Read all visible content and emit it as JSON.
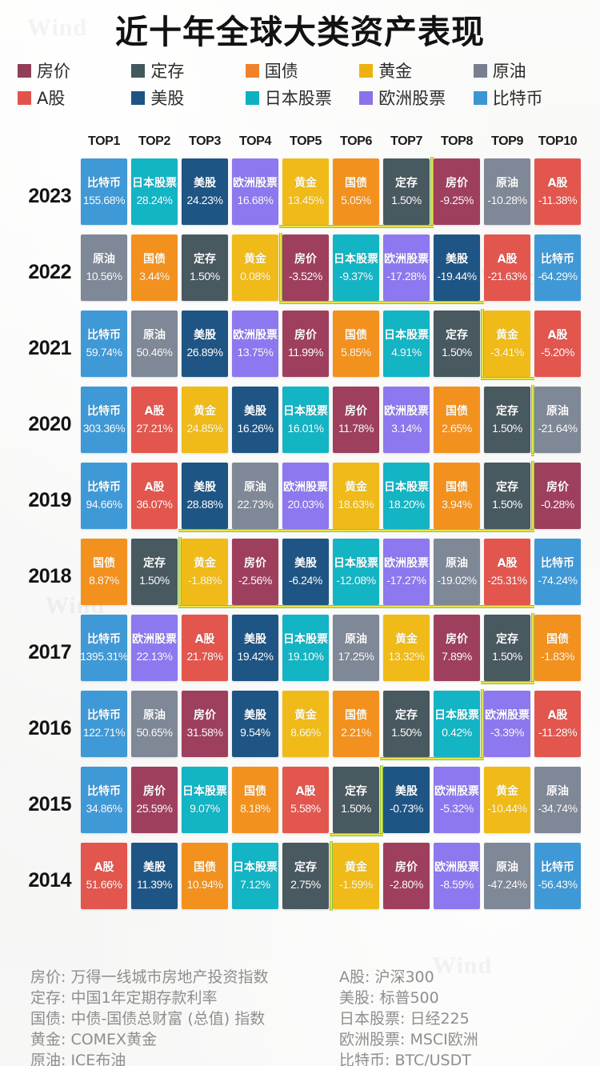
{
  "title": "近十年全球大类资产表现",
  "legend": [
    {
      "label": "房价",
      "color": "#8f3f56"
    },
    {
      "label": "定存",
      "color": "#41585c"
    },
    {
      "label": "国债",
      "color": "#f08129"
    },
    {
      "label": "黄金",
      "color": "#edb211"
    },
    {
      "label": "原油",
      "color": "#78808f"
    },
    {
      "label": "A股",
      "color": "#e0544c"
    },
    {
      "label": "美股",
      "color": "#1d5483"
    },
    {
      "label": "日本股票",
      "color": "#0eb0c0"
    },
    {
      "label": "欧洲股票",
      "color": "#8b72e8"
    },
    {
      "label": "比特币",
      "color": "#3b96d2"
    }
  ],
  "asset_colors": {
    "房价": "#9e3f5e",
    "定存": "#48595f",
    "国债": "#f3911f",
    "黄金": "#f0bb18",
    "原油": "#7f8897",
    "A股": "#e2564e",
    "美股": "#1e5585",
    "日本股票": "#13b4c4",
    "欧洲股票": "#8d78ef",
    "比特币": "#3f99d6"
  },
  "columns": [
    "TOP1",
    "TOP2",
    "TOP3",
    "TOP4",
    "TOP5",
    "TOP6",
    "TOP7",
    "TOP8",
    "TOP9",
    "TOP10"
  ],
  "chart_data": {
    "type": "table",
    "title": "近十年全球大类资产表现",
    "xlabel": "",
    "ylabel": "",
    "columns": [
      "TOP1",
      "TOP2",
      "TOP3",
      "TOP4",
      "TOP5",
      "TOP6",
      "TOP7",
      "TOP8",
      "TOP9",
      "TOP10"
    ],
    "rows": [
      {
        "year": "2023",
        "cells": [
          {
            "asset": "比特币",
            "value": "155.68%"
          },
          {
            "asset": "日本股票",
            "value": "28.24%"
          },
          {
            "asset": "美股",
            "value": "24.23%"
          },
          {
            "asset": "欧洲股票",
            "value": "16.68%"
          },
          {
            "asset": "黄金",
            "value": "13.45%"
          },
          {
            "asset": "国债",
            "value": "5.05%"
          },
          {
            "asset": "定存",
            "value": "1.50%"
          },
          {
            "asset": "房价",
            "value": "-9.25%"
          },
          {
            "asset": "原油",
            "value": "-10.28%"
          },
          {
            "asset": "A股",
            "value": "-11.38%"
          }
        ]
      },
      {
        "year": "2022",
        "cells": [
          {
            "asset": "原油",
            "value": "10.56%"
          },
          {
            "asset": "国债",
            "value": "3.44%"
          },
          {
            "asset": "定存",
            "value": "1.50%"
          },
          {
            "asset": "黄金",
            "value": "0.08%"
          },
          {
            "asset": "房价",
            "value": "-3.52%"
          },
          {
            "asset": "日本股票",
            "value": "-9.37%"
          },
          {
            "asset": "欧洲股票",
            "value": "-17.28%"
          },
          {
            "asset": "美股",
            "value": "-19.44%"
          },
          {
            "asset": "A股",
            "value": "-21.63%"
          },
          {
            "asset": "比特币",
            "value": "-64.29%"
          }
        ]
      },
      {
        "year": "2021",
        "cells": [
          {
            "asset": "比特币",
            "value": "59.74%"
          },
          {
            "asset": "原油",
            "value": "50.46%"
          },
          {
            "asset": "美股",
            "value": "26.89%"
          },
          {
            "asset": "欧洲股票",
            "value": "13.75%"
          },
          {
            "asset": "房价",
            "value": "11.99%"
          },
          {
            "asset": "国债",
            "value": "5.85%"
          },
          {
            "asset": "日本股票",
            "value": "4.91%"
          },
          {
            "asset": "定存",
            "value": "1.50%"
          },
          {
            "asset": "黄金",
            "value": "-3.41%"
          },
          {
            "asset": "A股",
            "value": "-5.20%"
          }
        ]
      },
      {
        "year": "2020",
        "cells": [
          {
            "asset": "比特币",
            "value": "303.36%"
          },
          {
            "asset": "A股",
            "value": "27.21%"
          },
          {
            "asset": "黄金",
            "value": "24.85%"
          },
          {
            "asset": "美股",
            "value": "16.26%"
          },
          {
            "asset": "日本股票",
            "value": "16.01%"
          },
          {
            "asset": "房价",
            "value": "11.78%"
          },
          {
            "asset": "欧洲股票",
            "value": "3.14%"
          },
          {
            "asset": "国债",
            "value": "2.65%"
          },
          {
            "asset": "定存",
            "value": "1.50%"
          },
          {
            "asset": "原油",
            "value": "-21.64%"
          }
        ]
      },
      {
        "year": "2019",
        "cells": [
          {
            "asset": "比特币",
            "value": "94.66%"
          },
          {
            "asset": "A股",
            "value": "36.07%"
          },
          {
            "asset": "美股",
            "value": "28.88%"
          },
          {
            "asset": "原油",
            "value": "22.73%"
          },
          {
            "asset": "欧洲股票",
            "value": "20.03%"
          },
          {
            "asset": "黄金",
            "value": "18.63%"
          },
          {
            "asset": "日本股票",
            "value": "18.20%"
          },
          {
            "asset": "国债",
            "value": "3.94%"
          },
          {
            "asset": "定存",
            "value": "1.50%"
          },
          {
            "asset": "房价",
            "value": "-0.28%"
          }
        ]
      },
      {
        "year": "2018",
        "cells": [
          {
            "asset": "国债",
            "value": "8.87%"
          },
          {
            "asset": "定存",
            "value": "1.50%"
          },
          {
            "asset": "黄金",
            "value": "-1.88%"
          },
          {
            "asset": "房价",
            "value": "-2.56%"
          },
          {
            "asset": "美股",
            "value": "-6.24%"
          },
          {
            "asset": "日本股票",
            "value": "-12.08%"
          },
          {
            "asset": "欧洲股票",
            "value": "-17.27%"
          },
          {
            "asset": "原油",
            "value": "-19.02%"
          },
          {
            "asset": "A股",
            "value": "-25.31%"
          },
          {
            "asset": "比特币",
            "value": "-74.24%"
          }
        ]
      },
      {
        "year": "2017",
        "cells": [
          {
            "asset": "比特币",
            "value": "1395.31%"
          },
          {
            "asset": "欧洲股票",
            "value": "22.13%"
          },
          {
            "asset": "A股",
            "value": "21.78%"
          },
          {
            "asset": "美股",
            "value": "19.42%"
          },
          {
            "asset": "日本股票",
            "value": "19.10%"
          },
          {
            "asset": "原油",
            "value": "17.25%"
          },
          {
            "asset": "黄金",
            "value": "13.32%"
          },
          {
            "asset": "房价",
            "value": "7.89%"
          },
          {
            "asset": "定存",
            "value": "1.50%"
          },
          {
            "asset": "国债",
            "value": "-1.83%"
          }
        ]
      },
      {
        "year": "2016",
        "cells": [
          {
            "asset": "比特币",
            "value": "122.71%"
          },
          {
            "asset": "原油",
            "value": "50.65%"
          },
          {
            "asset": "房价",
            "value": "31.58%"
          },
          {
            "asset": "美股",
            "value": "9.54%"
          },
          {
            "asset": "黄金",
            "value": "8.66%"
          },
          {
            "asset": "国债",
            "value": "2.21%"
          },
          {
            "asset": "定存",
            "value": "1.50%"
          },
          {
            "asset": "日本股票",
            "value": "0.42%"
          },
          {
            "asset": "欧洲股票",
            "value": "-3.39%"
          },
          {
            "asset": "A股",
            "value": "-11.28%"
          }
        ]
      },
      {
        "year": "2015",
        "cells": [
          {
            "asset": "比特币",
            "value": "34.86%"
          },
          {
            "asset": "房价",
            "value": "25.59%"
          },
          {
            "asset": "日本股票",
            "value": "9.07%"
          },
          {
            "asset": "国债",
            "value": "8.18%"
          },
          {
            "asset": "A股",
            "value": "5.58%"
          },
          {
            "asset": "定存",
            "value": "1.50%"
          },
          {
            "asset": "美股",
            "value": "-0.73%"
          },
          {
            "asset": "欧洲股票",
            "value": "-5.32%"
          },
          {
            "asset": "黄金",
            "value": "-10.44%"
          },
          {
            "asset": "原油",
            "value": "-34.74%"
          }
        ]
      },
      {
        "year": "2014",
        "cells": [
          {
            "asset": "A股",
            "value": "51.66%"
          },
          {
            "asset": "美股",
            "value": "11.39%"
          },
          {
            "asset": "国债",
            "value": "10.94%"
          },
          {
            "asset": "日本股票",
            "value": "7.12%"
          },
          {
            "asset": "定存",
            "value": "2.75%"
          },
          {
            "asset": "黄金",
            "value": "-1.59%"
          },
          {
            "asset": "房价",
            "value": "-2.80%"
          },
          {
            "asset": "欧洲股票",
            "value": "-8.59%"
          },
          {
            "asset": "原油",
            "value": "-47.24%"
          },
          {
            "asset": "比特币",
            "value": "-56.43%"
          }
        ]
      }
    ],
    "annotation": "黄绿色阶梯线标示各年度正负收益分界",
    "positive_counts": [
      7,
      4,
      8,
      9,
      9,
      2,
      9,
      8,
      6,
      5
    ]
  },
  "notes_left": [
    "房价: 万得一线城市房地产投资指数",
    "定存: 中国1年定期存款利率",
    "国债: 中债-国债总财富 (总值) 指数",
    "黄金: COMEX黄金",
    "原油: ICE布油"
  ],
  "notes_right": [
    "A股: 沪深300",
    "美股: 标普500",
    "日本股票: 日经225",
    "欧洲股票: MSCI欧洲",
    "比特币: BTC/USDT"
  ],
  "watermarks": [
    "Wind",
    "Wind",
    "Wind",
    "Wind"
  ]
}
